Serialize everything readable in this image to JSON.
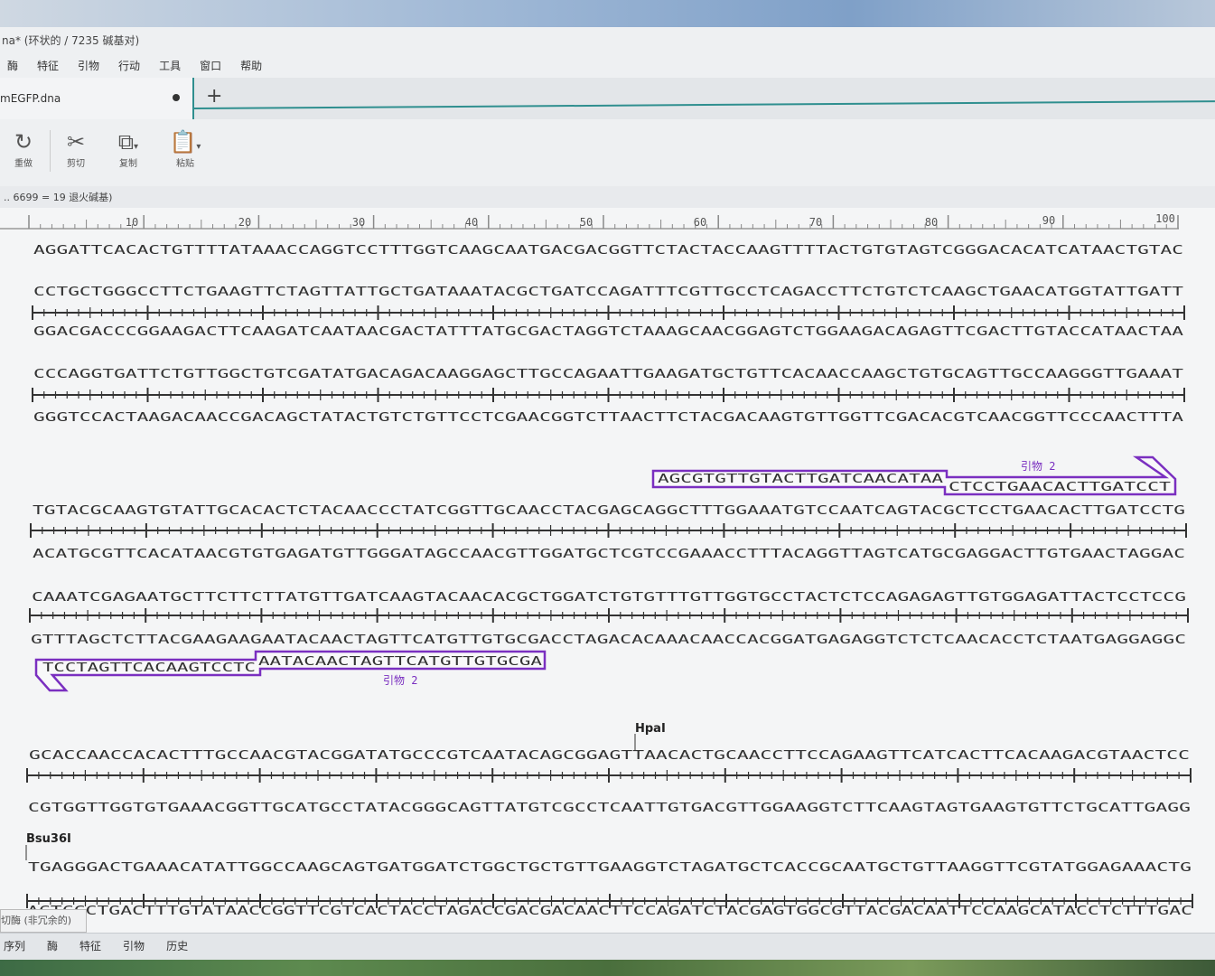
{
  "window": {
    "title": "na* (环状的 / 7235 碱基对)"
  },
  "menu": [
    "酶",
    "特征",
    "引物",
    "行动",
    "工具",
    "窗口",
    "帮助"
  ],
  "tab": {
    "filename": "mEGFP.dna",
    "new_tab": "+"
  },
  "toolbar": {
    "redo": "重做",
    "cut": "剪切",
    "copy": "复制",
    "paste": "粘贴"
  },
  "status": {
    "text": ".. 6699 = 19 退火碱基)"
  },
  "ruler": {
    "ticks": [
      "10",
      "20",
      "30",
      "40",
      "50",
      "60",
      "70",
      "80",
      "90",
      "100"
    ]
  },
  "sequence": {
    "row1_bottom": "AGGATTCACACTGTTTTATAAACCAGGTCCTTTGGTCAAGCAATGACGACGGTTCTACTACCAAGTTTTACTGTGTAGTCGGGACACATCATAACTGTAC",
    "block1_top": "CCTGCTGGGCCTTCTGAAGTTCTAGTTATTGCTGATAAATACGCTGATCCAGATTTCGTTGCCTCAGACCTTCTGTCTCAAGCTGAACATGGTATTGATT",
    "block1_bottom": "GGACGACCCGGAAGACTTCAAGATCAATAACGACTATTTATGCGACTAGGTCTAAAGCAACGGAGTCTGGAAGACAGAGTTCGACTTGTACCATAACTAA",
    "block2_top": "CCCAGGTGATTCTGTTGGCTGTCGATATGACAGACAAGGAGCTTGCCAGAATTGAAGATGCTGTTCACAACCAAGCTGTGCAGTTGCCAAGGGTTGAAAT",
    "block2_bottom": "GGGTCCACTAAGACAACCGACAGCTATACTGTCTGTTCCTCGAACGGTCTTAACTTCTACGACAAGTGTTGGTTCGACACGTCAACGGTTCCCAACTTTA",
    "block3_top": "TGTACGCAAGTGTATTGCACACTCTACAACCCTATCGGTTGCAACCTACGAGCAGGCTTTGGAAATGTCCAATCAGTACGCTCCTGAACACTTGATCCTG",
    "block3_bottom": "ACATGCGTTCACATAACGTGTGAGATGTTGGGATAGCCAACGTTGGATGCTCGTCCGAAACCTTTACAGGTTAGTCATGCGAGGACTTGTGAACTAGGAC",
    "block4_top": "CAAATCGAGAATGCTTCTTCTTATGTTGATCAAGTACAACACGCTGGATCTGTGTTTGTTGGTGCCTACTCTCCAGAGAGTTGTGGAGATTACTCCTCCG",
    "block4_bottom": "GTTTAGCTCTTACGAAGAAGAATACAACTAGTTCATGTTGTGCGACCTAGACACAAACAACCACGGATGAGAGGTCTCTCAACACCTCTAATGAGGAGGC",
    "block5_top": "GCACCAACCACACTTTGCCAACGTACGGATATGCCCGTCAATACAGCGGAGTTAACACTGCAACCTTCCAGAAGTTCATCACTTCACAAGACGTAACTCC",
    "block5_bottom": "CGTGGTTGGTGTGAAACGGTTGCATGCCTATACGGGCAGTTATGTCGCCTCAATTGTGACGTTGGAAGGTCTTCAAGTAGTGAAGTGTTCTGCATTGAGG",
    "block6_top": "TGAGGGACTGAAACATATTGGCCAAGCAGTGATGGATCTGGCTGCTGTTGAAGGTCTAGATGCTCACCGCAATGCTGTTAAGGTTCGTATGGAGAAACTG",
    "block6_bottom": "ACTCCCTGACTTTGTATAACCGGTTCGTCACTACCTAGACCGACGACAACTTCCAGATCTACGAGTGGCGTTACGACAATTCCAAGCATACCTCTTTGAC"
  },
  "primers": {
    "p1_upper": "AGCGTGTTGTACTTGATCAACATAA",
    "p1_lower": "CTCCTGAACACTTGATCCT",
    "p1_label": "引物 2",
    "p2_left": "TCCTAGTTCACAAGTCCTC",
    "p2_right": "AATACAACTAGTTCATGTTGTGCGA",
    "p2_label": "引物 2",
    "primer_color": "#7a2fc0"
  },
  "enzymes": {
    "hpa": "HpaI",
    "bsu": "Bsu36I"
  },
  "enzyme_panel": {
    "label": "切酶 (非冗余的)"
  },
  "bottom_tabs": [
    "序列",
    "酶",
    "特征",
    "引物",
    "历史"
  ]
}
